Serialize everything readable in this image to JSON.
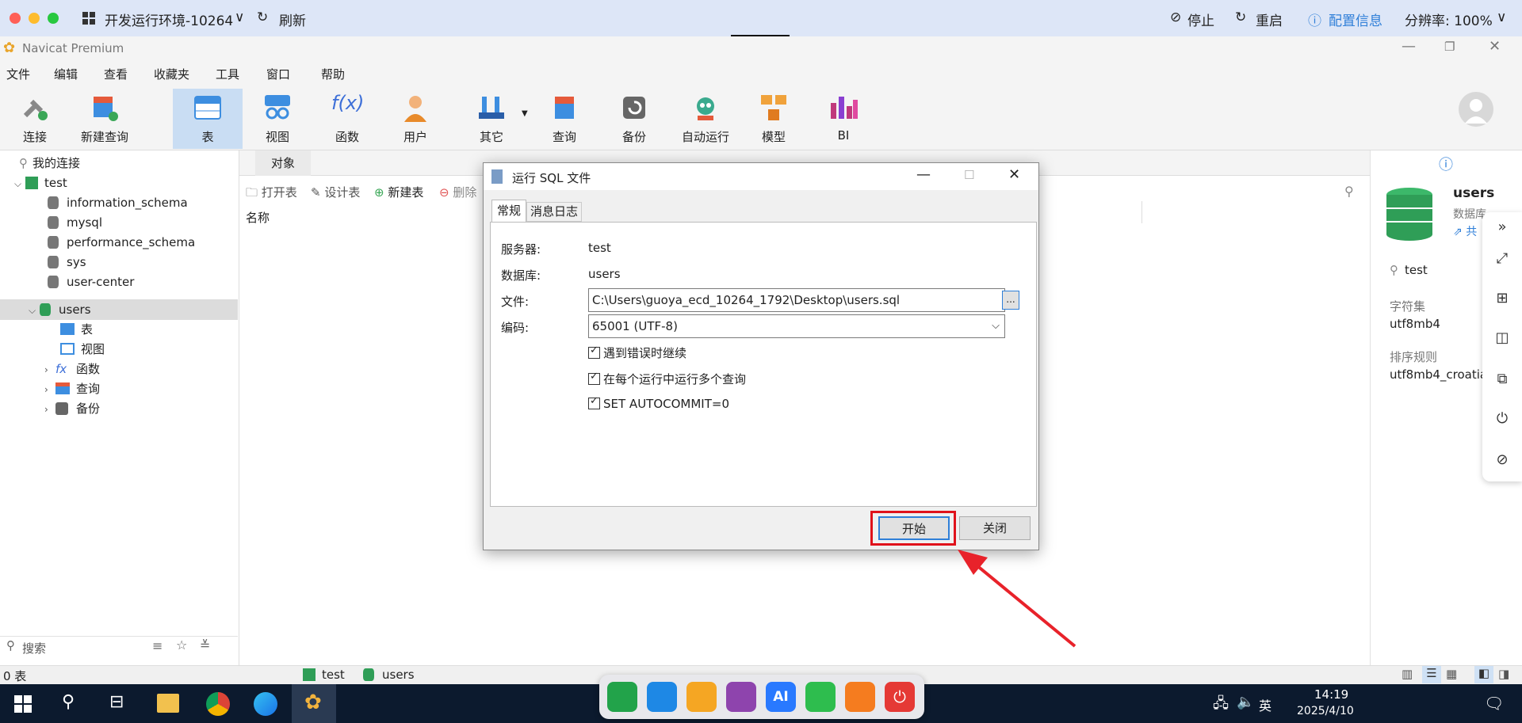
{
  "host": {
    "env_title": "开发运行环境-10264",
    "refresh": "刷新",
    "stop": "停止",
    "restart": "重启",
    "config": "配置信息",
    "resolution": "分辨率: 100%"
  },
  "app": {
    "title": "Navicat Premium",
    "menu": [
      "文件",
      "编辑",
      "查看",
      "收藏夹",
      "工具",
      "窗口",
      "帮助"
    ],
    "toolbar": [
      "连接",
      "新建查询",
      "表",
      "视图",
      "函数",
      "用户",
      "其它",
      "查询",
      "备份",
      "自动运行",
      "模型",
      "BI"
    ]
  },
  "sidebar": {
    "root": "我的连接",
    "connection": "test",
    "databases": [
      "information_schema",
      "mysql",
      "performance_schema",
      "sys",
      "user-center",
      "users"
    ],
    "children": [
      "表",
      "视图",
      "函数",
      "查询",
      "备份"
    ],
    "search_placeholder": "搜索"
  },
  "objects": {
    "tab": "对象",
    "actions": [
      "打开表",
      "设计表",
      "新建表",
      "删除"
    ],
    "column": "名称"
  },
  "dialog": {
    "title": "运行 SQL 文件",
    "tabs": [
      "常规",
      "消息日志"
    ],
    "server_label": "服务器:",
    "server_value": "test",
    "db_label": "数据库:",
    "db_value": "users",
    "file_label": "文件:",
    "file_value": "C:\\Users\\guoya_ecd_10264_1792\\Desktop\\users.sql",
    "browse": "...",
    "encoding_label": "编码:",
    "encoding_value": "65001 (UTF-8)",
    "checks": [
      "遇到错误时继续",
      "在每个运行中运行多个查询",
      "SET AUTOCOMMIT=0"
    ],
    "start": "开始",
    "close": "关闭"
  },
  "info": {
    "name": "users",
    "type": "数据库",
    "share": "共",
    "connection": "test",
    "charset_label": "字符集",
    "charset_value": "utf8mb4",
    "collation_label": "排序规则",
    "collation_value": "utf8mb4_croatia"
  },
  "status": {
    "count": "0 表",
    "conn": "test",
    "db": "users"
  },
  "taskbar": {
    "time": "14:19",
    "date": "2025/4/10",
    "lang": "英",
    "ai": "AI"
  },
  "colors": {
    "highlight": "#e0121b",
    "arrow": "#e8222a",
    "accent": "#2f7fd8"
  }
}
